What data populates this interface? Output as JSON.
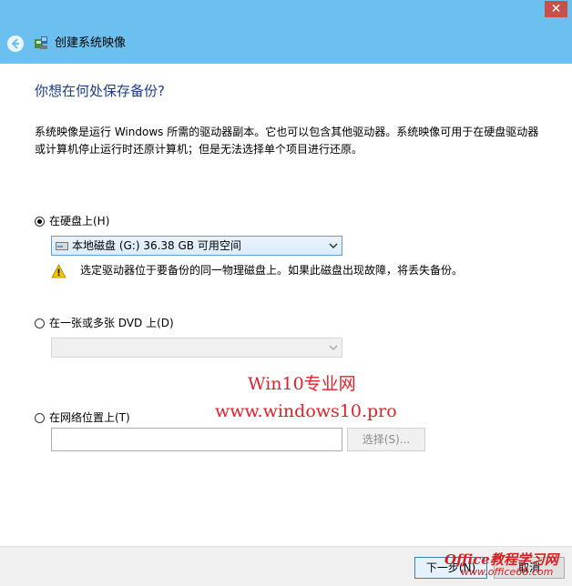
{
  "window": {
    "close_glyph": "✕"
  },
  "header": {
    "title": "创建系统映像"
  },
  "main": {
    "heading": "你想在何处保存备份?",
    "description": "系统映像是运行 Windows 所需的驱动器副本。它也可以包含其他驱动器。系统映像可用于在硬盘驱动器或计算机停止运行时还原计算机；但是无法选择单个项目进行还原。"
  },
  "options": {
    "hard_disk": {
      "label": "在硬盘上(H)",
      "selected": true,
      "drive_value": "本地磁盘 (G:)  36.38 GB 可用空间",
      "warning": "选定驱动器位于要备份的同一物理磁盘上。如果此磁盘出现故障，将丢失备份。"
    },
    "dvd": {
      "label": "在一张或多张 DVD 上(D)",
      "selected": false,
      "drive_value": ""
    },
    "network": {
      "label": "在网络位置上(T)",
      "selected": false,
      "path_value": "",
      "browse_label": "选择(S)..."
    }
  },
  "watermark": {
    "line1": "Win10专业网",
    "line2": "www.windows10.pro",
    "logo_line1": "Office教程学习网",
    "logo_line2": "www.office68.com"
  },
  "footer": {
    "next_label": "下一步(N)",
    "cancel_label": "取消"
  },
  "colors": {
    "titlebar": "#6cc0f0",
    "heading": "#1c3a92",
    "watermark": "#e0202a"
  }
}
